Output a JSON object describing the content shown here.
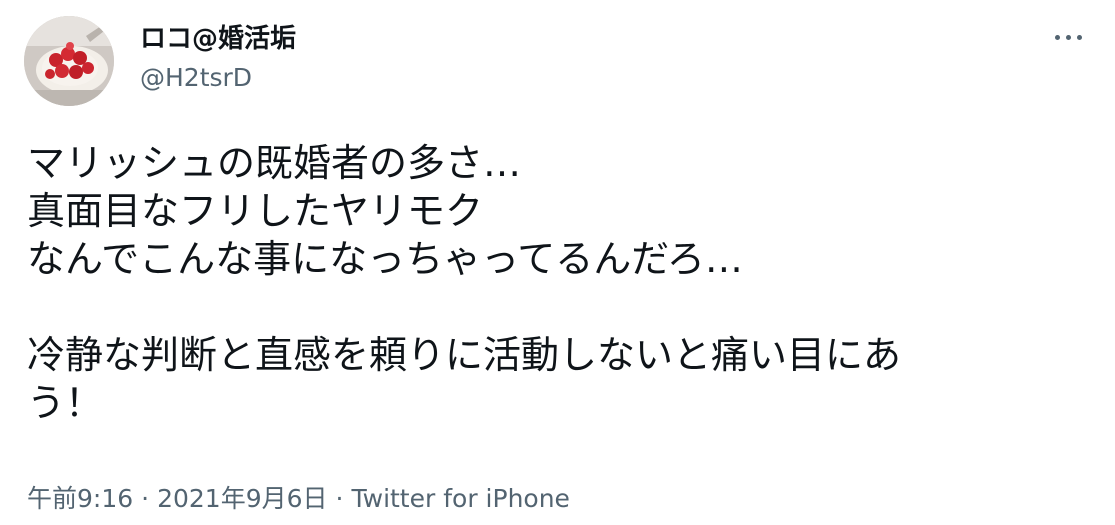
{
  "author": {
    "display_name": "ロコ@婚活垢",
    "handle": "@H2tsrD",
    "avatar_icon": "avatar-strawberry-cake-icon"
  },
  "more_icon": "more-horizontal-icon",
  "tweet": {
    "lines": [
      "マリッシュの既婚者の多さ…",
      "真面目なフリしたヤリモク",
      "なんでこんな事になっちゃってるんだろ…",
      "",
      "冷静な判断と直感を頼りに活動しないと痛い目にあ",
      "う！"
    ]
  },
  "meta": {
    "time": "午前9:16",
    "separator": "·",
    "date": "2021年9月6日",
    "source": "Twitter for iPhone"
  },
  "colors": {
    "text": "#0f1419",
    "secondary": "#536471",
    "background": "#ffffff"
  }
}
